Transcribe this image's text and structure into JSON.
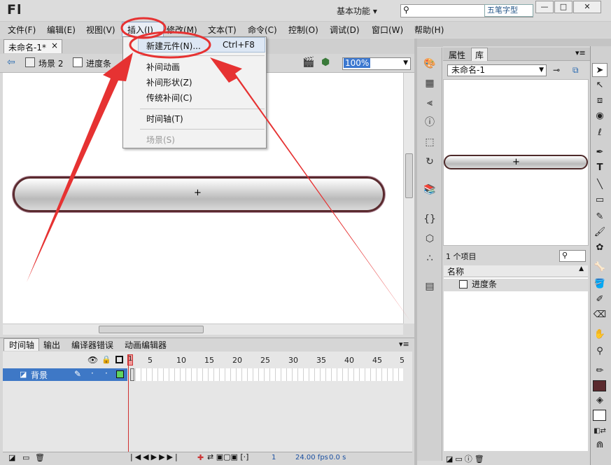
{
  "app": {
    "logo": "Fl",
    "workspace": "基本功能 ▾",
    "ime_label": "五笔字型"
  },
  "window": {
    "minimize": "—",
    "maximize": "□",
    "close": "✕"
  },
  "menubar": [
    "文件(F)",
    "编辑(E)",
    "视图(V)",
    "插入(I)",
    "修改(M)",
    "文本(T)",
    "命令(C)",
    "控制(O)",
    "调试(D)",
    "窗口(W)",
    "帮助(H)"
  ],
  "insert_menu": {
    "new_symbol": "新建元件(N)...",
    "new_symbol_shortcut": "Ctrl+F8",
    "motion_tween": "补间动画",
    "shape_tween": "补间形状(Z)",
    "classic_tween": "传统补间(C)",
    "timeline": "时间轴(T)",
    "scene": "场景(S)"
  },
  "document": {
    "tab": "未命名-1*",
    "tab_close": "×"
  },
  "editbar": {
    "scene": "场景 2",
    "symbol": "进度条",
    "zoom": "100%"
  },
  "timeline": {
    "tabs": [
      "时间轴",
      "输出",
      "编译器错误",
      "动画编辑器"
    ],
    "layer_name": "背景",
    "ruler": [
      "1",
      "5",
      "10",
      "15",
      "20",
      "25",
      "30",
      "35",
      "40",
      "45",
      "5"
    ],
    "current_frame": "1",
    "fps": "24.00 fps",
    "time": "0.0 s"
  },
  "library": {
    "tabs": [
      "属性",
      "库"
    ],
    "doc_select": "未命名-1",
    "count": "1 个项目",
    "col_name": "名称",
    "items": [
      "进度条"
    ]
  },
  "colors": {
    "annotation_red": "#e63232",
    "pill_stroke": "#5a2a2e",
    "layer_select": "#3e78c6"
  }
}
